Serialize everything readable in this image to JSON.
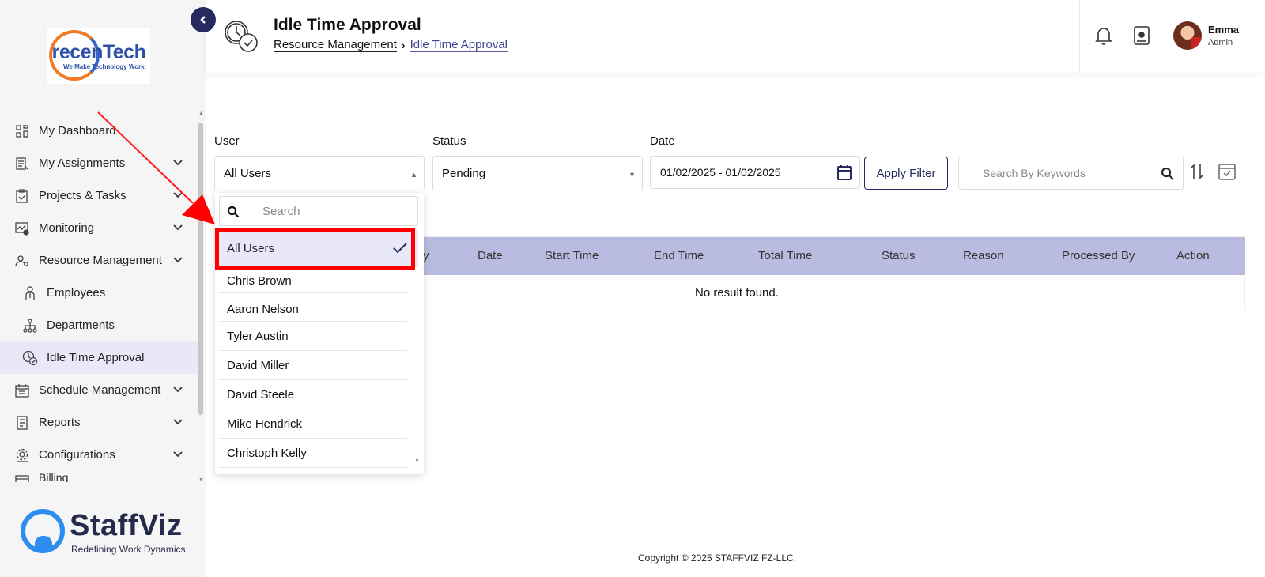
{
  "sidebar": {
    "logo": {
      "brand": "recenTech",
      "tagline": "We Make Technology Work"
    },
    "items": [
      {
        "label": "My Dashboard",
        "icon": "dashboard-icon",
        "expandable": false
      },
      {
        "label": "My Assignments",
        "icon": "assignments-icon",
        "expandable": true
      },
      {
        "label": "Projects & Tasks",
        "icon": "clipboard-check-icon",
        "expandable": true
      },
      {
        "label": "Monitoring",
        "icon": "monitoring-icon",
        "expandable": true
      },
      {
        "label": "Resource Management",
        "icon": "users-gear-icon",
        "expandable": true
      },
      {
        "label": "Employees",
        "icon": "employee-icon",
        "sub": true
      },
      {
        "label": "Departments",
        "icon": "org-chart-icon",
        "sub": true
      },
      {
        "label": "Idle Time Approval",
        "icon": "clock-check-icon",
        "sub": true,
        "active": true
      },
      {
        "label": "Schedule Management",
        "icon": "calendar-grid-icon",
        "expandable": true
      },
      {
        "label": "Reports",
        "icon": "report-icon",
        "expandable": true
      },
      {
        "label": "Configurations",
        "icon": "config-gear-icon",
        "expandable": true
      },
      {
        "label": "Billing",
        "icon": "billing-icon",
        "expandable": false
      }
    ],
    "footer_brand": {
      "name": "StaffViz",
      "tagline": "Redefining Work Dynamics"
    }
  },
  "header": {
    "title": "Idle Time Approval",
    "breadcrumb": [
      "Resource Management",
      "Idle Time Approval"
    ],
    "user": {
      "name": "Emma",
      "role": "Admin"
    }
  },
  "filters": {
    "user_label": "User",
    "user_value": "All Users",
    "status_label": "Status",
    "status_value": "Pending",
    "date_label": "Date",
    "date_value": "01/02/2025 - 01/02/2025",
    "apply_label": "Apply Filter",
    "search_placeholder": "Search By Keywords"
  },
  "dropdown": {
    "search_placeholder": "Search",
    "selected": "All Users",
    "options": [
      "Chris Brown",
      "Aaron Nelson",
      "Tyler Austin",
      "David Miller",
      "David Steele",
      "Mike Hendrick",
      "Christoph Kelly"
    ]
  },
  "table": {
    "partial_header": "y",
    "columns": [
      "Date",
      "Start Time",
      "End Time",
      "Total Time",
      "Status",
      "Reason",
      "Processed By",
      "Action"
    ],
    "empty_text": "No result found."
  },
  "footer": {
    "copyright": "Copyright © 2025 STAFFVIZ FZ-LLC."
  },
  "colors": {
    "accent": "#262a5c",
    "table_header": "#b9bce0",
    "active_item": "#e8e8f8",
    "annotation": "#ff0000"
  }
}
